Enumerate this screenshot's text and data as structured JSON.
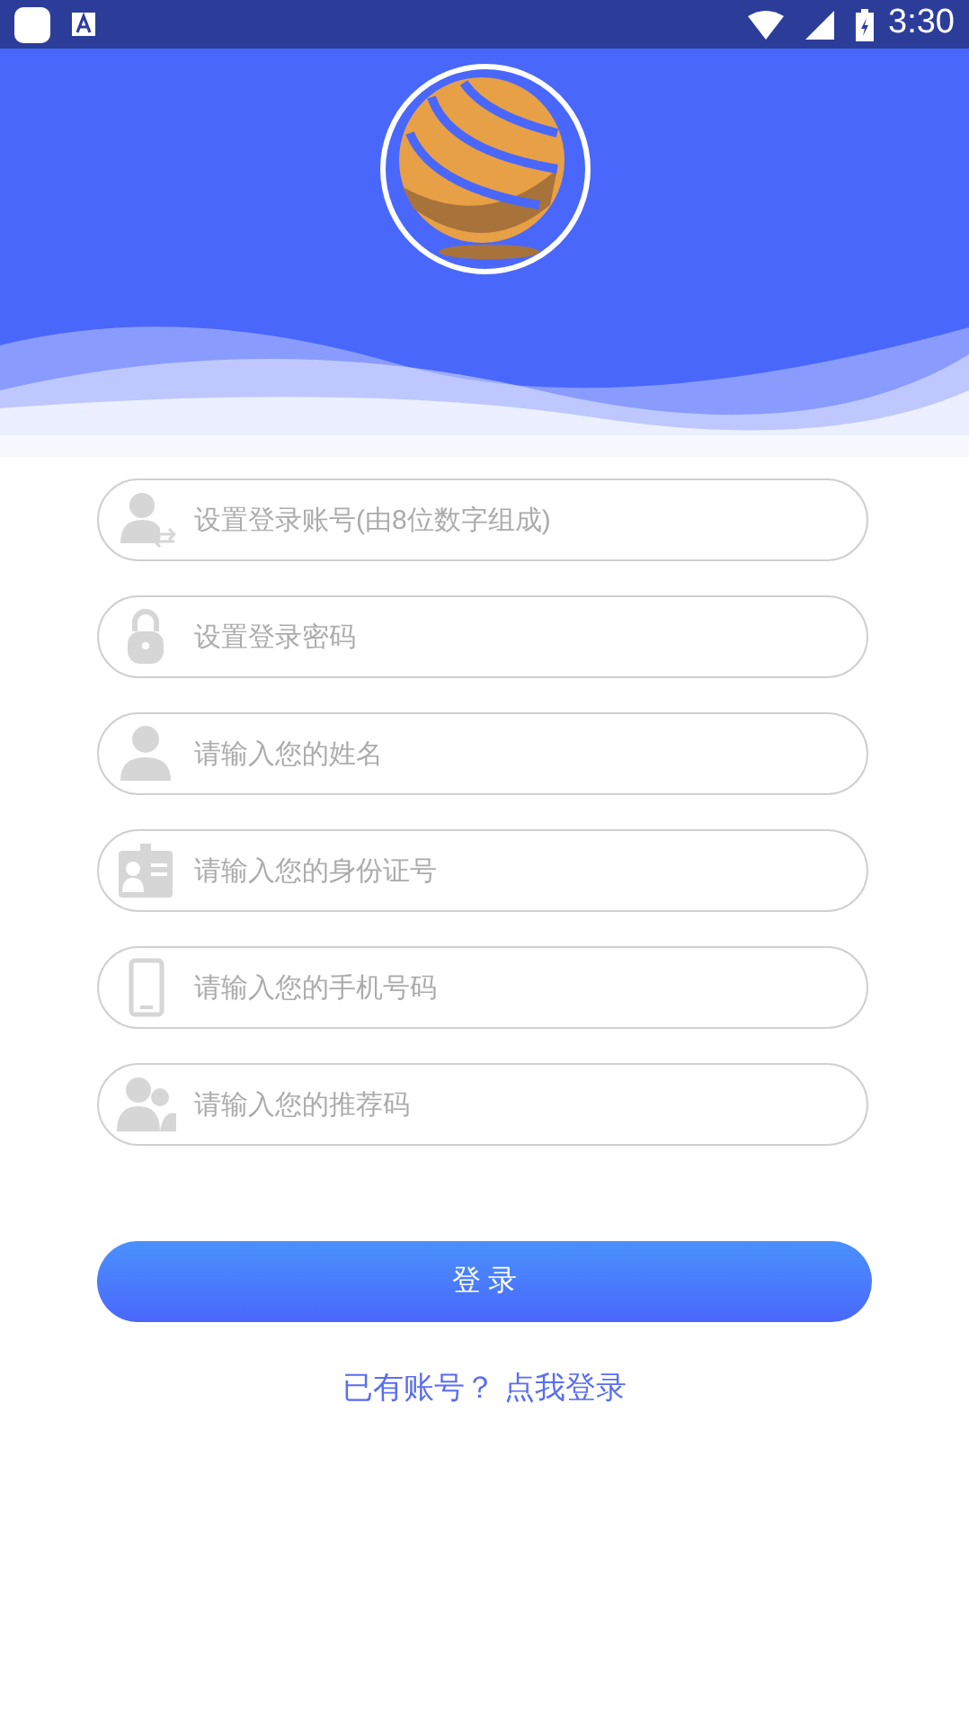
{
  "status_bar": {
    "time": "3:30"
  },
  "fields": [
    {
      "kind": "account",
      "placeholder": "设置登录账号(由8位数字组成)"
    },
    {
      "kind": "lock",
      "placeholder": "设置登录密码"
    },
    {
      "kind": "person",
      "placeholder": "请输入您的姓名"
    },
    {
      "kind": "id-card",
      "placeholder": "请输入您的身份证号"
    },
    {
      "kind": "phone",
      "placeholder": "请输入您的手机号码"
    },
    {
      "kind": "people",
      "placeholder": "请输入您的推荐码"
    }
  ],
  "submit_button": "登 录",
  "login_link": "已有账号？ 点我登录"
}
